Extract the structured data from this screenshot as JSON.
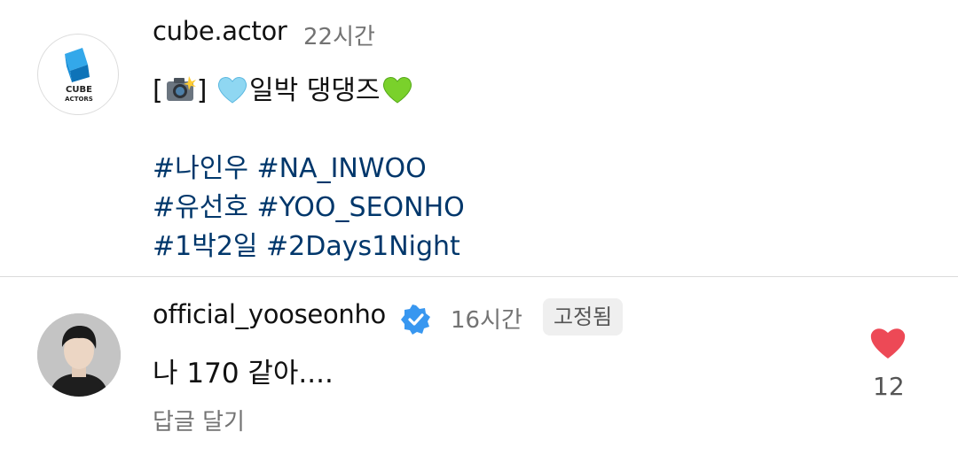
{
  "post": {
    "username": "cube.actor",
    "time": "22시간",
    "avatar_text_top": "CUBE",
    "avatar_text_bottom": "ACTORS",
    "caption_open": "[",
    "caption_close": "]",
    "caption_text": "일박 댕댕즈",
    "hashtags": [
      "#나인우 #NA_INWOO",
      "#유선호 #YOO_SEONHO",
      "#1박2일 #2Days1Night"
    ],
    "icons": [
      "camera-flash-icon",
      "light-blue-heart-icon",
      "green-heart-icon"
    ]
  },
  "comment": {
    "username": "official_yooseonho",
    "verified": true,
    "time": "16시간",
    "pinned_label": "고정됨",
    "text": "나 170 같아....",
    "reply_label": "답글 달기",
    "like_count": "12",
    "liked": true
  },
  "colors": {
    "hashtag": "#00376b",
    "secondary_text": "#737373",
    "like_red": "#ed4956",
    "verified_blue": "#3897f0",
    "cube_blue": "#1a8fd8"
  }
}
